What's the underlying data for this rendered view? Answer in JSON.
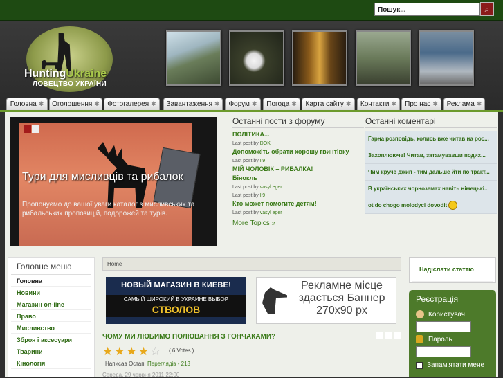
{
  "search": {
    "placeholder": "Пошук..."
  },
  "logo": {
    "part1": "Hunting",
    "part2": "Ukraine",
    "subtitle": "ЛОВЕЦТВО УКРАЇНИ"
  },
  "nav": [
    "Головна",
    "Оголошення",
    "Фотогалерея",
    "Завантаження",
    "Форум",
    "Погода",
    "Карта сайту",
    "Контакти",
    "Про нас",
    "Реклама"
  ],
  "slider": {
    "title": "Тури для мисливців та рибалок",
    "text": "Пропонуємо до вашої уваги каталог з мисливських та рибальських пропозицій, подорожей та турів."
  },
  "forum": {
    "title": "Останні пости з форуму",
    "posts": [
      {
        "title": "ПОЛІТИКА...",
        "meta": "Last post by",
        "user": "DOK"
      },
      {
        "title": "Допоможіть обрати хорошу гвинтівку",
        "meta": "Last post by",
        "user": "Il9"
      },
      {
        "title": "МІЙ ЧОЛОВІК – РИБАЛКА!",
        "meta": "Last post by",
        "user": "vasyl eger"
      },
      {
        "title": "Бінокль",
        "meta": "Last post by",
        "user": "Il9"
      },
      {
        "title": "Кто может помогите детям!",
        "meta": "Last post by",
        "user": "vasyl eger"
      }
    ],
    "more": "More Topics »"
  },
  "comments": {
    "title": "Останні коментарі",
    "items": [
      "Гарна розповідь, колись вже читав на рос...",
      "Захоплююче! Читав, затамувавши подих...",
      "Чим круче джип - тим дальше йти по тракт...",
      "В українських чорноземах навіть німецькі...",
      "ot do chogo molodyci dovodit"
    ]
  },
  "menu": {
    "title": "Головне меню",
    "items": [
      "Головна",
      "Новини",
      "Магазин on-line",
      "Право",
      "Мисливство",
      "Зброя і аксесуари",
      "Тварини",
      "Кінологія"
    ]
  },
  "breadcrumb": "Home",
  "banner1": {
    "line1": "НОВЫЙ МАГАЗИН В КИЕВЕ!",
    "line2": "САМЫЙ ШИРОКИЙ В УКРАИНЕ ВЫБОР",
    "line3": "СТВОЛОВ"
  },
  "banner2": {
    "text": "Рекламне місце здається Баннер 270x90 px"
  },
  "article": {
    "title": "ЧОМУ МИ ЛЮБИМО ПОЛЮВАННЯ З ГОНЧАКАМИ?",
    "votes": "( 6 Votes )",
    "rating": 4,
    "author_label": "Написав",
    "author": "Остап",
    "views": "Переглядів - 213",
    "date": "Середа, 29 червня 2011 22:00"
  },
  "submit": {
    "label": "Надіслати статтю"
  },
  "register": {
    "title": "Реєстрація",
    "user": "Користувач",
    "pass": "Пароль",
    "remember": "Запам'ятати мене"
  }
}
